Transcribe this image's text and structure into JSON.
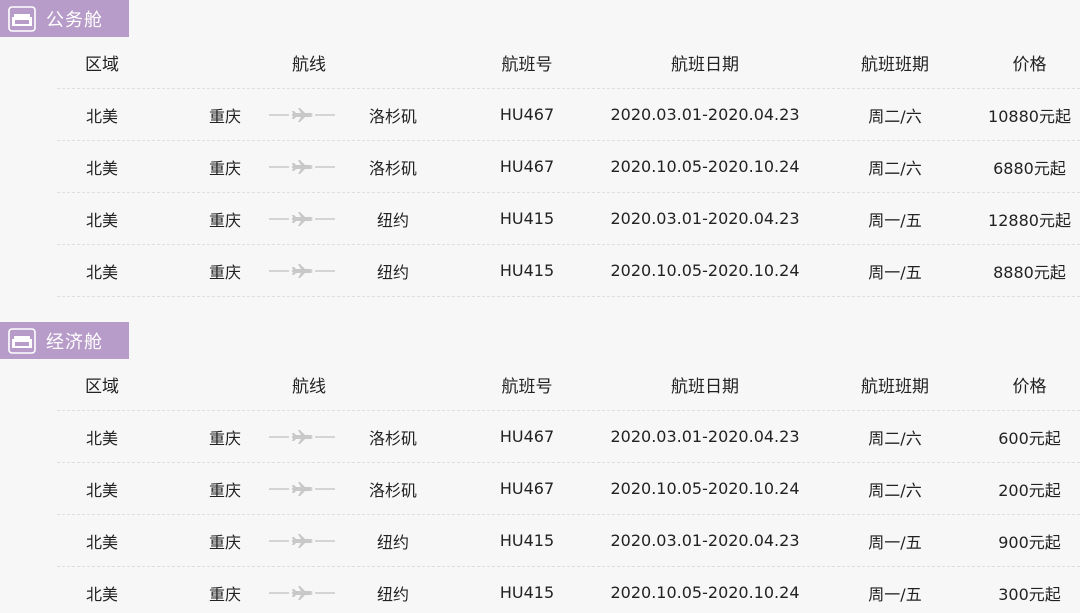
{
  "sections": [
    {
      "title": "公务舱",
      "header": {
        "region": "区域",
        "route": "航线",
        "flight": "航班号",
        "date": "航班日期",
        "schedule": "航班班期",
        "price": "价格"
      },
      "rows": [
        {
          "region": "北美",
          "from": "重庆",
          "to": "洛杉矶",
          "flight": "HU467",
          "date": "2020.03.01-2020.04.23",
          "schedule": "周二/六",
          "price": "10880元起"
        },
        {
          "region": "北美",
          "from": "重庆",
          "to": "洛杉矶",
          "flight": "HU467",
          "date": "2020.10.05-2020.10.24",
          "schedule": "周二/六",
          "price": "6880元起"
        },
        {
          "region": "北美",
          "from": "重庆",
          "to": "纽约",
          "flight": "HU415",
          "date": "2020.03.01-2020.04.23",
          "schedule": "周一/五",
          "price": "12880元起"
        },
        {
          "region": "北美",
          "from": "重庆",
          "to": "纽约",
          "flight": "HU415",
          "date": "2020.10.05-2020.10.24",
          "schedule": "周一/五",
          "price": "8880元起"
        }
      ]
    },
    {
      "title": "经济舱",
      "header": {
        "region": "区域",
        "route": "航线",
        "flight": "航班号",
        "date": "航班日期",
        "schedule": "航班班期",
        "price": "价格"
      },
      "rows": [
        {
          "region": "北美",
          "from": "重庆",
          "to": "洛杉矶",
          "flight": "HU467",
          "date": "2020.03.01-2020.04.23",
          "schedule": "周二/六",
          "price": "600元起"
        },
        {
          "region": "北美",
          "from": "重庆",
          "to": "洛杉矶",
          "flight": "HU467",
          "date": "2020.10.05-2020.10.24",
          "schedule": "周二/六",
          "price": "200元起"
        },
        {
          "region": "北美",
          "from": "重庆",
          "to": "纽约",
          "flight": "HU415",
          "date": "2020.03.01-2020.04.23",
          "schedule": "周一/五",
          "price": "900元起"
        },
        {
          "region": "北美",
          "from": "重庆",
          "to": "纽约",
          "flight": "HU415",
          "date": "2020.10.05-2020.10.24",
          "schedule": "周一/五",
          "price": "300元起"
        }
      ]
    }
  ],
  "icons": {
    "badge": "sofa-icon",
    "route": "airplane-icon"
  },
  "colors": {
    "badge": "#b79bc8",
    "plane": "#c8c8c8",
    "divider": "#dedede"
  }
}
